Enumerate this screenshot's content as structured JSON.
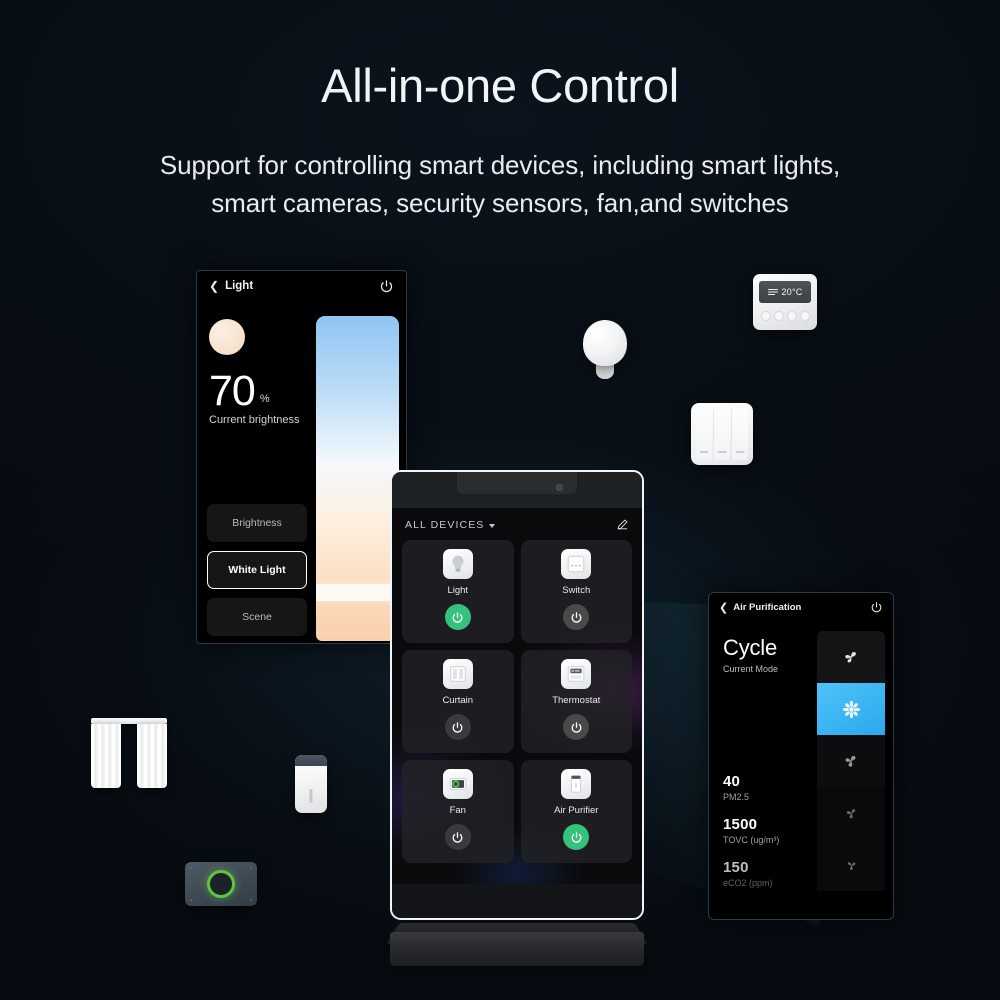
{
  "header": {
    "title": "All-in-one Control",
    "subtitle_line1": "Support for controlling smart devices, including smart lights,",
    "subtitle_line2": "smart cameras, security sensors, fan,and switches"
  },
  "light_panel": {
    "back_icon": "chevron-left-icon",
    "title": "Light",
    "power_icon": "power-icon",
    "value": "70",
    "unit": "%",
    "caption": "Current brightness",
    "buttons": [
      {
        "label": "Brightness",
        "active": false
      },
      {
        "label": "White Light",
        "active": true
      },
      {
        "label": "Scene",
        "active": false
      }
    ],
    "slider_top_color": "#8fc5f2",
    "slider_bottom_color": "#f9d0ac"
  },
  "tablet": {
    "section_title": "ALL DEVICES",
    "edit_icon": "pencil-icon",
    "devices": [
      {
        "label": "Light",
        "icon": "bulb-icon",
        "power": "on"
      },
      {
        "label": "Switch",
        "icon": "switch-icon",
        "power": "off"
      },
      {
        "label": "Curtain",
        "icon": "curtain-icon",
        "power": "dim"
      },
      {
        "label": "Thermostat",
        "icon": "thermostat-icon",
        "power": "off"
      },
      {
        "label": "Fan",
        "icon": "camera-icon",
        "power": "dim"
      },
      {
        "label": "Air Purifier",
        "icon": "purifier-icon",
        "power": "on"
      }
    ],
    "power_on_color": "#35c27c"
  },
  "air_panel": {
    "back_icon": "chevron-left-icon",
    "title": "Air Purification",
    "power_icon": "power-icon",
    "mode": "Cycle",
    "mode_caption": "Current Mode",
    "stats": [
      {
        "value": "40",
        "label": "PM2.5"
      },
      {
        "value": "1500",
        "label": "TOVC (ug/m³)"
      },
      {
        "value": "150",
        "label": "eCO2 (ppm)"
      }
    ],
    "fan_levels": [
      "fan-icon-1",
      "fan-icon-2",
      "fan-icon-3",
      "fan-icon-4",
      "fan-icon-5"
    ],
    "selected_fan_index": 1,
    "selected_color": "#2aa8ee"
  },
  "floating_devices": {
    "bulb": {
      "name": "smart-bulb"
    },
    "thermostat": {
      "name": "smart-thermostat",
      "display_temp": "20°C"
    },
    "wall_switch": {
      "name": "wall-switch-3gang"
    },
    "curtain": {
      "name": "smart-curtain"
    },
    "purifier": {
      "name": "air-purifier"
    },
    "camera": {
      "name": "security-camera"
    }
  }
}
